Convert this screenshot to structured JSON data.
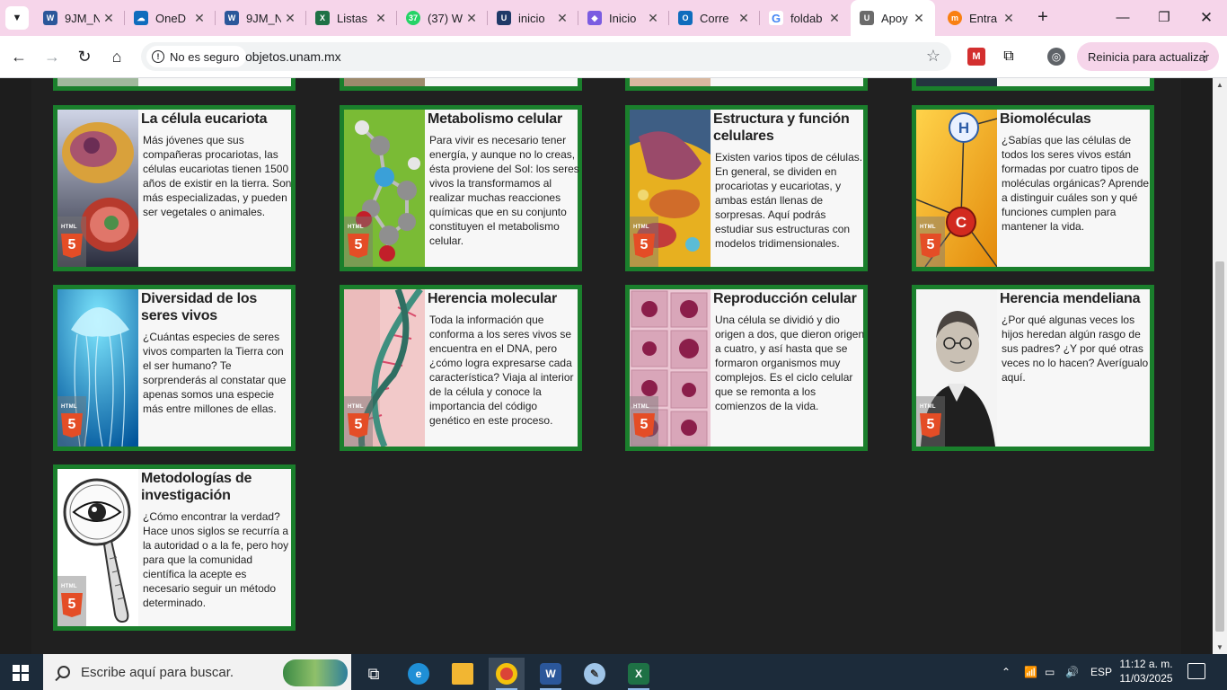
{
  "browser": {
    "tabs": [
      {
        "title": "9JM_N",
        "icon": "word-icon",
        "color": "#2b579a",
        "glyph": "W"
      },
      {
        "title": "OneD",
        "icon": "onedrive-icon",
        "color": "#0f6cbd",
        "glyph": "☁"
      },
      {
        "title": "9JM_N",
        "icon": "word-icon",
        "color": "#2b579a",
        "glyph": "W"
      },
      {
        "title": "Listas",
        "icon": "excel-icon",
        "color": "#1e7145",
        "glyph": "X"
      },
      {
        "title": "(37) W",
        "icon": "whatsapp-icon",
        "color": "#25d366",
        "glyph": "37"
      },
      {
        "title": "inicio",
        "icon": "unam-icon",
        "color": "#1f3a68",
        "glyph": "U"
      },
      {
        "title": "Inicio",
        "icon": "copilot-icon",
        "color": "#7b5ce1",
        "glyph": "◆"
      },
      {
        "title": "Corre",
        "icon": "outlook-icon",
        "color": "#0f6cbd",
        "glyph": "O"
      },
      {
        "title": "foldab",
        "icon": "google-icon",
        "color": "#4285f4",
        "glyph": "G"
      },
      {
        "title": "Apoy",
        "icon": "unam-seal-icon",
        "color": "#6b6b6b",
        "glyph": "U"
      },
      {
        "title": "Entra",
        "icon": "moodle-icon",
        "color": "#f98012",
        "glyph": "m"
      }
    ],
    "not_secure_label": "No es seguro",
    "url": "objetos.unam.mx",
    "restart_label": "Reinicia para actualizar"
  },
  "cards": [
    {
      "title": "La célula eucariota",
      "text": "Más jóvenes que sus compañeras procariotas, las células eucariotas tienen 1500 años de existir en la tierra. Son más especializadas, y pueden ser vegetales o animales."
    },
    {
      "title": "Metabolismo celular",
      "text": "Para vivir es necesario tener energía, y aunque no lo creas, ésta proviene del Sol: los seres vivos la transformamos al realizar muchas reacciones químicas que en su conjunto constituyen el metabolismo celular."
    },
    {
      "title": "Estructura y función celulares",
      "text": "Existen varios tipos de células. En general, se dividen en procariotas y eucariotas, y ambas están llenas de sorpresas. Aquí podrás estudiar sus estructuras con modelos tridimensionales."
    },
    {
      "title": "Biomoléculas",
      "text": "¿Sabías que las células de todos los seres vivos están formadas por cuatro tipos de moléculas orgánicas? Aprende a distinguir cuáles son y qué funciones cumplen para mantener la vida."
    },
    {
      "title": "Diversidad de los seres vivos",
      "text": "¿Cuántas especies de seres vivos comparten la Tierra con el ser humano? Te sorprenderás al constatar que apenas somos una especie más entre millones de ellas."
    },
    {
      "title": "Herencia molecular",
      "text": "Toda la información que conforma a los seres vivos se encuentra en el DNA, pero ¿cómo logra expresarse cada característica? Viaja al interior de la célula y conoce la importancia del código genético en este proceso."
    },
    {
      "title": "Reproducción celular",
      "text": "Una célula se dividió y dio origen a dos, que dieron origen a cuatro, y así hasta que se formaron organismos muy complejos. Es el ciclo celular que se remonta a los comienzos de la vida."
    },
    {
      "title": "Herencia mendeliana",
      "text": "¿Por qué algunas veces los hijos heredan algún rasgo de sus padres? ¿Y por qué otras veces no lo hacen? Averígualo aquí."
    },
    {
      "title": "Metodologías de investigación",
      "text": "¿Cómo encontrar la verdad? Hace unos siglos se recurría a la autoridad o a la fe, pero hoy para que la comunidad científica la acepte es necesario seguir un método determinado."
    }
  ],
  "badge": {
    "label": "HTML",
    "number": "5"
  },
  "molecule_atoms": {
    "h": "H",
    "c": "C"
  },
  "taskbar": {
    "search_placeholder": "Escribe aquí para buscar.",
    "language": "ESP",
    "time": "11:12 a. m.",
    "date": "11/03/2025"
  }
}
